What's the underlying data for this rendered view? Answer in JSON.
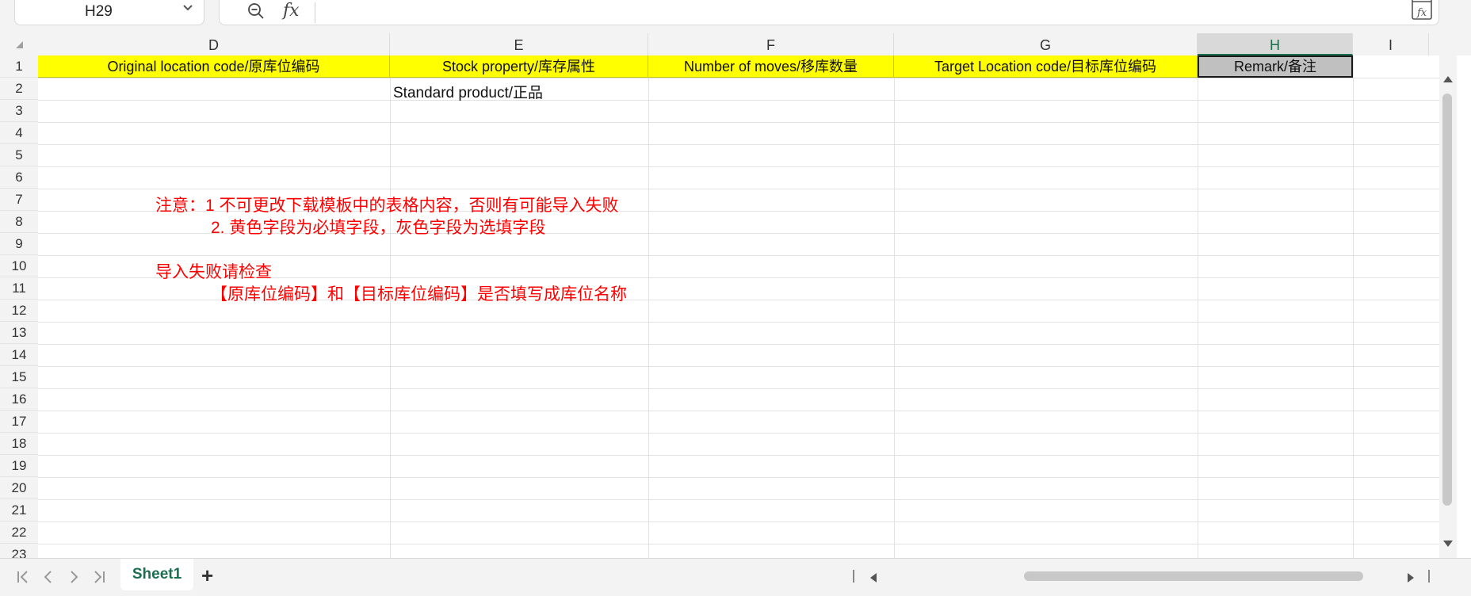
{
  "formula_bar": {
    "cell_reference": "H29",
    "fx_label": "fx",
    "formula_value": ""
  },
  "columns": [
    {
      "letter": "D",
      "header": "Original location code/原库位编码",
      "fill": "#ffff00"
    },
    {
      "letter": "E",
      "header": "Stock property/库存属性",
      "fill": "#ffff00"
    },
    {
      "letter": "F",
      "header": "Number of moves/移库数量",
      "fill": "#ffff00"
    },
    {
      "letter": "G",
      "header": "Target Location code/目标库位编码",
      "fill": "#ffff00"
    },
    {
      "letter": "H",
      "header": "Remark/备注",
      "fill": "#c0c0c0"
    },
    {
      "letter": "I",
      "header": "",
      "fill": ""
    }
  ],
  "active_column": "H",
  "row_numbers": [
    "1",
    "2",
    "3",
    "4",
    "5",
    "6",
    "7",
    "8",
    "9",
    "10",
    "11",
    "12",
    "13",
    "14",
    "15",
    "16",
    "17",
    "18",
    "19",
    "20",
    "21",
    "22",
    "23"
  ],
  "cells": {
    "E2": "Standard product/正品"
  },
  "notes": {
    "line1": "注意：1  不可更改下载模板中的表格内容，否则有可能导入失败",
    "line2": "2. 黄色字段为必填字段，灰色字段为选填字段",
    "line3": "导入失败请检查",
    "line4": "【原库位编码】和【目标库位编码】是否填写成库位名称",
    "color": "#ff0000"
  },
  "sheets": [
    {
      "name": "Sheet1",
      "active": true
    }
  ],
  "add_sheet_label": "+"
}
